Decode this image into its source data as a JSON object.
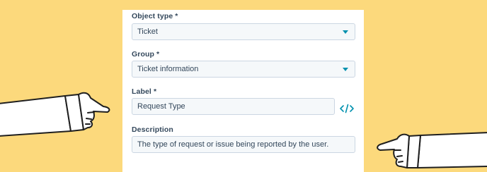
{
  "form": {
    "object_type": {
      "label": "Object type *",
      "value": "Ticket"
    },
    "group": {
      "label": "Group *",
      "value": "Ticket information"
    },
    "label_field": {
      "label": "Label *",
      "value": "Request Type"
    },
    "description": {
      "label": "Description",
      "value": "The type of request or issue being reported by the user."
    }
  },
  "icons": {
    "dropdown": "chevron-down-icon",
    "code": "code-icon",
    "hand_left": "pointing-hand-right-illustration",
    "hand_right": "pointing-hand-left-illustration"
  },
  "colors": {
    "background": "#fcd97c",
    "panel": "#ffffff",
    "accent": "#0091ae",
    "text": "#33475b",
    "field_bg": "#f5f8fa",
    "field_border": "#cbd6e2"
  }
}
